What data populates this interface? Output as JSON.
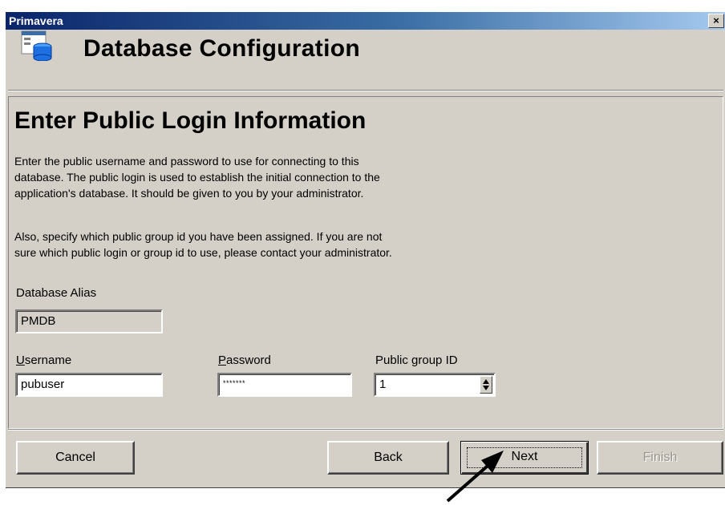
{
  "window": {
    "title": "Primavera",
    "close_label": "×"
  },
  "header": {
    "title": "Database Configuration",
    "icon": "database-icon"
  },
  "section": {
    "title": "Enter Public Login Information",
    "paragraph1_lines": [
      "Enter the public username and password to use for connecting to this",
      "database.  The public login is used to establish the initial connection to the",
      "application's database.  It should be given to you by your administrator."
    ],
    "paragraph2_lines": [
      "Also, specify which public group id you have been assigned.  If you are not",
      "sure which public login or group id to use, please contact your administrator."
    ]
  },
  "form": {
    "alias_label": "Database Alias",
    "alias_value": "PMDB",
    "username_label": {
      "first": "U",
      "rest": "sername"
    },
    "username_value": "pubuser",
    "password_label": {
      "first": "P",
      "rest": "assword"
    },
    "password_value": "*******",
    "group_label": {
      "before": "Public ",
      "underlined": "g",
      "after": "roup ID"
    },
    "group_value": "1"
  },
  "buttons": {
    "cancel": "Cancel",
    "back": "Back",
    "next": "Next",
    "finish": "Finish"
  },
  "colors": {
    "titlebar_start": "#0a246a",
    "face": "#d4d0c8"
  }
}
